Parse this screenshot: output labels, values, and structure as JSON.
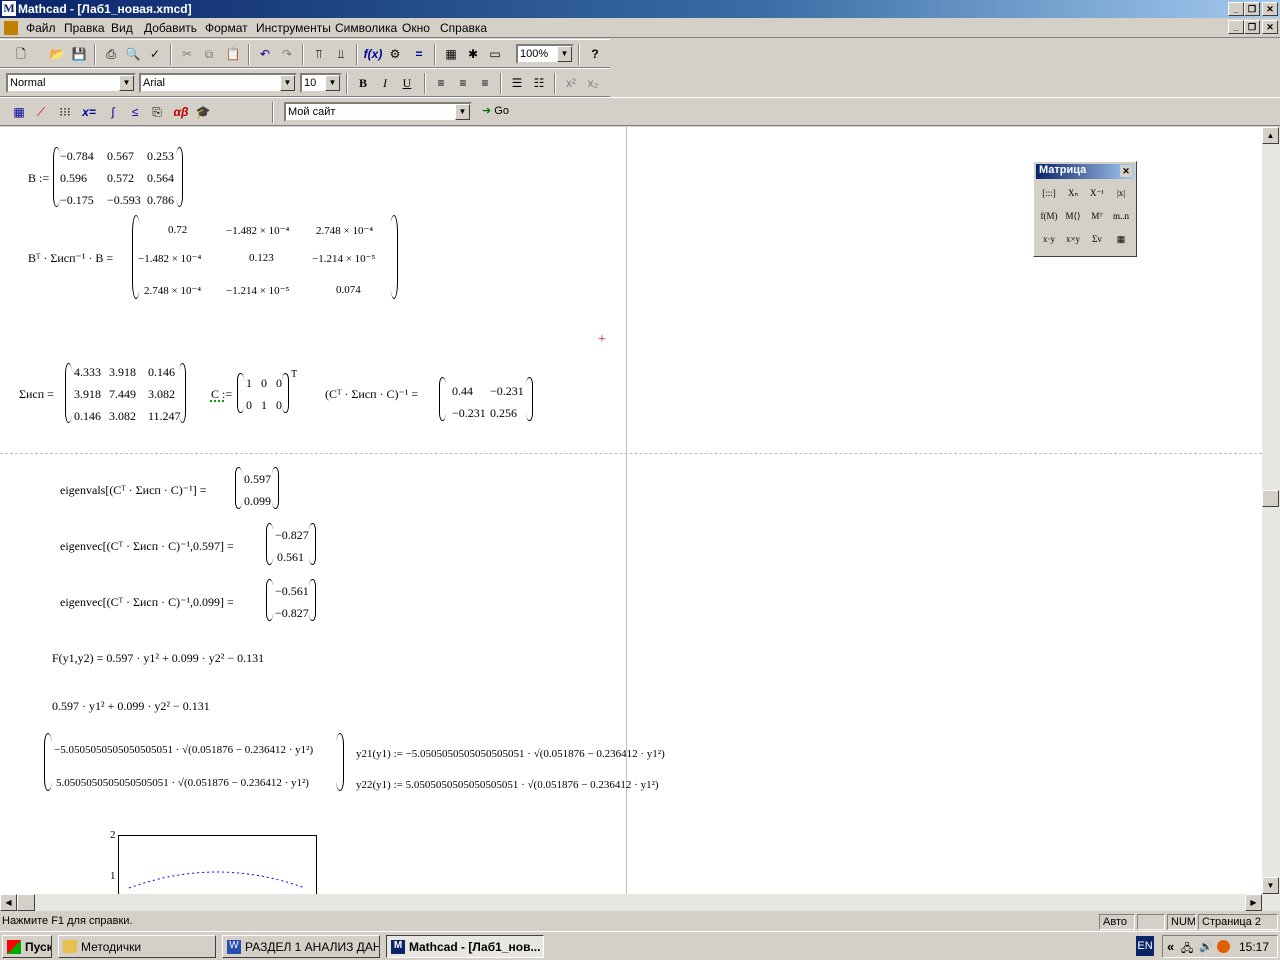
{
  "window": {
    "title": "Mathcad - [Лаб1_новая.xmcd]"
  },
  "menu": [
    "Файл",
    "Правка",
    "Вид",
    "Добавить",
    "Формат",
    "Инструменты",
    "Символика",
    "Окно",
    "Справка"
  ],
  "toolbar": {
    "zoom": "100%",
    "style": "Normal",
    "font": "Arial",
    "size": "10",
    "bold": "B",
    "italic": "I",
    "underline": "U",
    "site": "Мой сайт",
    "go": "Go"
  },
  "palette": {
    "title": "Матрица",
    "buttons": [
      "[:::]",
      "Xₙ",
      "X⁻¹",
      "|x|",
      "f(M)",
      "M⟨⟩",
      "Mᵀ",
      "m..n",
      "x·y",
      "x×y",
      "Σv",
      "▦"
    ]
  },
  "worksheet": {
    "B_lhs": "B :=",
    "B": [
      [
        "−0.784",
        "0.567",
        "0.253"
      ],
      [
        "0.596",
        "0.572",
        "0.564"
      ],
      [
        "−0.175",
        "−0.593",
        "0.786"
      ]
    ],
    "BT_lhs": "Bᵀ · Σисп⁻¹ · B =",
    "BT": [
      [
        "0.72",
        "−1.482 × 10⁻⁴",
        "2.748 × 10⁻⁴"
      ],
      [
        "−1.482 × 10⁻⁴",
        "0.123",
        "−1.214 × 10⁻⁵"
      ],
      [
        "2.748 × 10⁻⁴",
        "−1.214 × 10⁻⁵",
        "0.074"
      ]
    ],
    "S_lhs": "Σисп =",
    "S": [
      [
        "4.333",
        "3.918",
        "0.146"
      ],
      [
        "3.918",
        "7.449",
        "3.082"
      ],
      [
        "0.146",
        "3.082",
        "11.247"
      ]
    ],
    "C_lhs": "C :=",
    "C": [
      [
        "1",
        "0",
        "0"
      ],
      [
        "0",
        "1",
        "0"
      ]
    ],
    "C_T": "T",
    "Cinv_lhs": "(Cᵀ · Σисп · C)⁻¹ =",
    "Cinv": [
      [
        "0.44",
        "−0.231"
      ],
      [
        "−0.231",
        "0.256"
      ]
    ],
    "eig1_lhs": "eigenvals[(Cᵀ · Σисп · C)⁻¹] =",
    "eig1": [
      "0.597",
      "0.099"
    ],
    "eig2_lhs": "eigenvec[(Cᵀ · Σисп · C)⁻¹,0.597] =",
    "eig2": [
      "−0.827",
      "0.561"
    ],
    "eig3_lhs": "eigenvec[(Cᵀ · Σисп · C)⁻¹,0.099] =",
    "eig3": [
      "−0.561",
      "−0.827"
    ],
    "F": "F(y1,y2) = 0.597 · y1² + 0.099 · y2² − 0.131",
    "expr": "0.597 · y1² + 0.099 · y2² − 0.131",
    "sol1": "−5.0505050505050505051 · √(0.051876 − 0.236412 · y1²)",
    "sol2": "5.0505050505050505051 · √(0.051876 − 0.236412 · y1²)",
    "y21": "y21(y1) := −5.0505050505050505051 · √(0.051876 − 0.236412 · y1²)",
    "y22": "y22(y1) := 5.0505050505050505051 · √(0.051876 − 0.236412 · y1²)",
    "plot_ticks": [
      "2",
      "1"
    ]
  },
  "status": {
    "help": "Нажмите F1 для справки.",
    "auto": "Авто",
    "num": "NUM",
    "page": "Страница 2"
  },
  "taskbar": {
    "start": "Пуск",
    "items": [
      "Методички",
      "РАЗДЕЛ 1 АНАЛИЗ ДАН...",
      "Mathcad - [Лаб1_нов..."
    ],
    "lang": "EN",
    "clock": "15:17",
    "tray_arrows": "«"
  }
}
